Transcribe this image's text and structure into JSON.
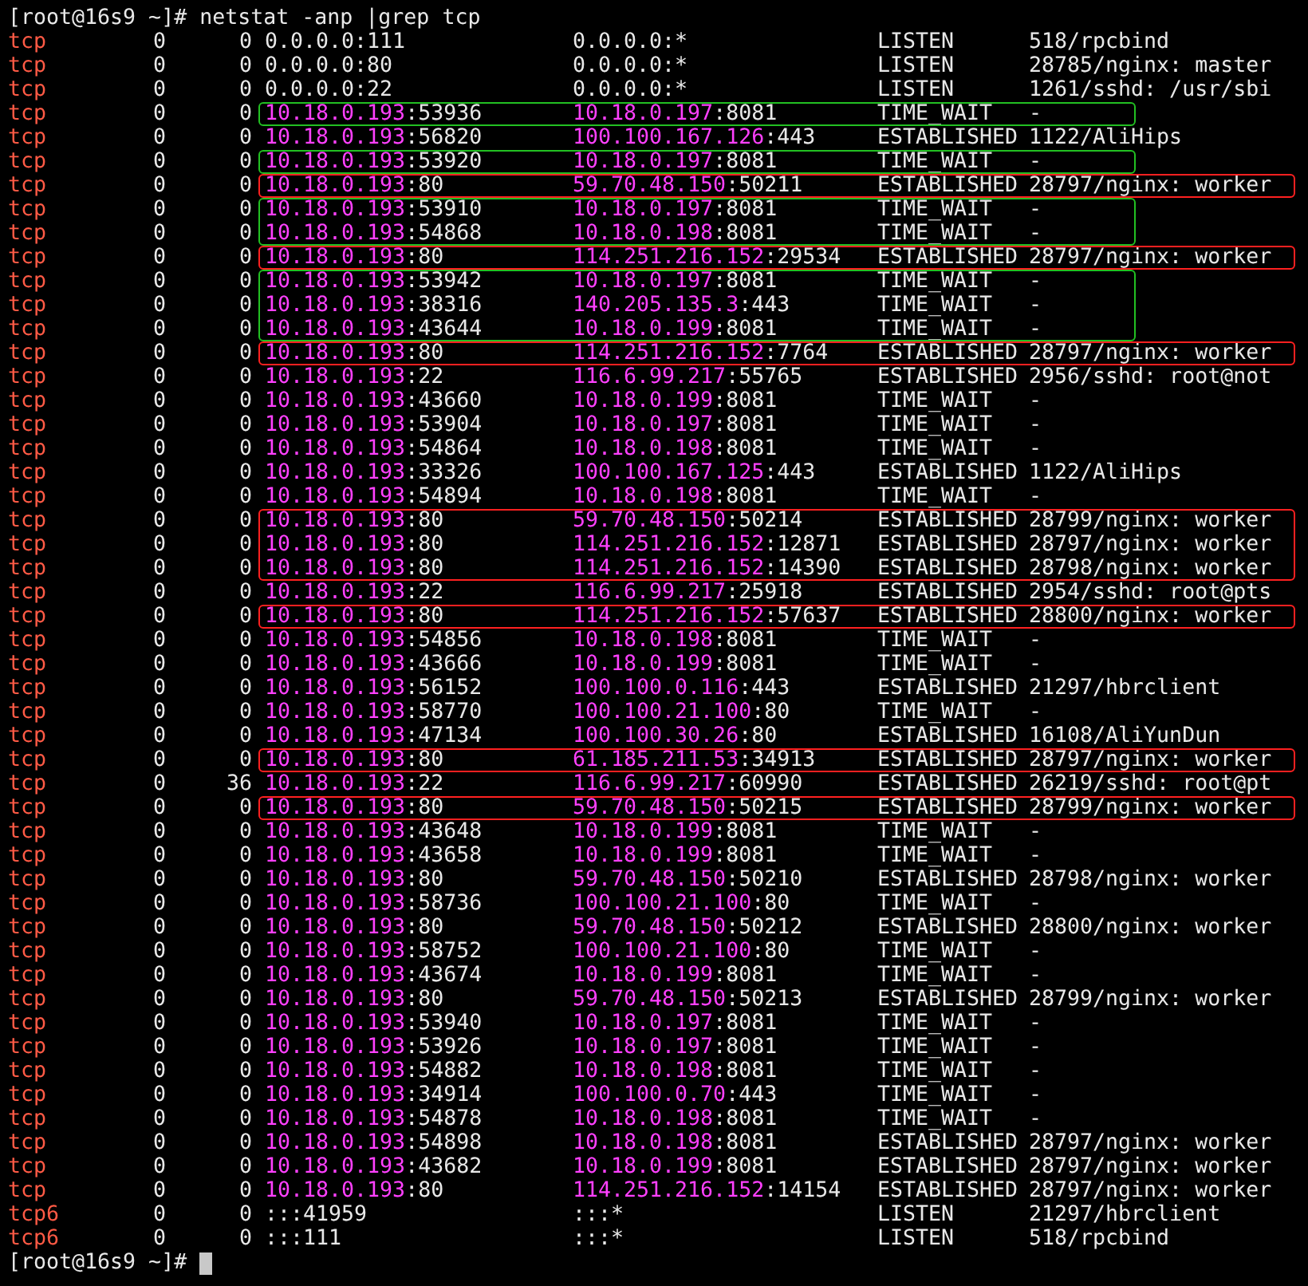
{
  "terminal": {
    "prompt": "[root@16s9 ~]#",
    "command": "netstat -anp |grep tcp",
    "lines": [
      {
        "kind": "row",
        "proto": "tcp",
        "recv_q": "0",
        "send_q": "0",
        "local": "0.0.0.0:111",
        "local_highlighted": false,
        "foreign": "0.0.0.0:*",
        "foreign_highlighted": false,
        "state": "LISTEN",
        "program": "518/rpcbind"
      },
      {
        "kind": "row",
        "proto": "tcp",
        "recv_q": "0",
        "send_q": "0",
        "local": "0.0.0.0:80",
        "local_highlighted": false,
        "foreign": "0.0.0.0:*",
        "foreign_highlighted": false,
        "state": "LISTEN",
        "program": "28785/nginx: master"
      },
      {
        "kind": "row",
        "proto": "tcp",
        "recv_q": "0",
        "send_q": "0",
        "local": "0.0.0.0:22",
        "local_highlighted": false,
        "foreign": "0.0.0.0:*",
        "foreign_highlighted": false,
        "state": "LISTEN",
        "program": "1261/sshd: /usr/sbi"
      },
      {
        "kind": "box",
        "color": "#22c022",
        "rows": [
          {
            "proto": "tcp",
            "recv_q": "0",
            "send_q": "0",
            "local": "10.18.0.193:53936",
            "local_highlighted": true,
            "foreign": "10.18.0.197:8081",
            "foreign_highlighted": true,
            "state": "TIME_WAIT",
            "program": "-"
          }
        ]
      },
      {
        "kind": "row",
        "proto": "tcp",
        "recv_q": "0",
        "send_q": "0",
        "local": "10.18.0.193:56820",
        "local_highlighted": true,
        "foreign": "100.100.167.126:443",
        "foreign_highlighted": true,
        "state": "ESTABLISHED",
        "program": "1122/AliHips"
      },
      {
        "kind": "box",
        "color": "#22c022",
        "rows": [
          {
            "proto": "tcp",
            "recv_q": "0",
            "send_q": "0",
            "local": "10.18.0.193:53920",
            "local_highlighted": true,
            "foreign": "10.18.0.197:8081",
            "foreign_highlighted": true,
            "state": "TIME_WAIT",
            "program": "-"
          }
        ]
      },
      {
        "kind": "box",
        "color": "#ff2020",
        "rows": [
          {
            "proto": "tcp",
            "recv_q": "0",
            "send_q": "0",
            "local": "10.18.0.193:80",
            "local_highlighted": true,
            "foreign": "59.70.48.150:50211",
            "foreign_highlighted": true,
            "state": "ESTABLISHED",
            "program": "28797/nginx: worker"
          }
        ]
      },
      {
        "kind": "box",
        "color": "#22c022",
        "rows": [
          {
            "proto": "tcp",
            "recv_q": "0",
            "send_q": "0",
            "local": "10.18.0.193:53910",
            "local_highlighted": true,
            "foreign": "10.18.0.197:8081",
            "foreign_highlighted": true,
            "state": "TIME_WAIT",
            "program": "-"
          },
          {
            "proto": "tcp",
            "recv_q": "0",
            "send_q": "0",
            "local": "10.18.0.193:54868",
            "local_highlighted": true,
            "foreign": "10.18.0.198:8081",
            "foreign_highlighted": true,
            "state": "TIME_WAIT",
            "program": "-"
          }
        ]
      },
      {
        "kind": "box",
        "color": "#ff2020",
        "rows": [
          {
            "proto": "tcp",
            "recv_q": "0",
            "send_q": "0",
            "local": "10.18.0.193:80",
            "local_highlighted": true,
            "foreign": "114.251.216.152:29534",
            "foreign_highlighted": true,
            "state": "ESTABLISHED",
            "program": "28797/nginx: worker"
          }
        ]
      },
      {
        "kind": "box",
        "color": "#22c022",
        "rows": [
          {
            "proto": "tcp",
            "recv_q": "0",
            "send_q": "0",
            "local": "10.18.0.193:53942",
            "local_highlighted": true,
            "foreign": "10.18.0.197:8081",
            "foreign_highlighted": true,
            "state": "TIME_WAIT",
            "program": "-"
          },
          {
            "proto": "tcp",
            "recv_q": "0",
            "send_q": "0",
            "local": "10.18.0.193:38316",
            "local_highlighted": true,
            "foreign": "140.205.135.3:443",
            "foreign_highlighted": true,
            "state": "TIME_WAIT",
            "program": "-"
          },
          {
            "proto": "tcp",
            "recv_q": "0",
            "send_q": "0",
            "local": "10.18.0.193:43644",
            "local_highlighted": true,
            "foreign": "10.18.0.199:8081",
            "foreign_highlighted": true,
            "state": "TIME_WAIT",
            "program": "-"
          }
        ]
      },
      {
        "kind": "box",
        "color": "#ff2020",
        "rows": [
          {
            "proto": "tcp",
            "recv_q": "0",
            "send_q": "0",
            "local": "10.18.0.193:80",
            "local_highlighted": true,
            "foreign": "114.251.216.152:7764",
            "foreign_highlighted": true,
            "state": "ESTABLISHED",
            "program": "28797/nginx: worker"
          }
        ]
      },
      {
        "kind": "row",
        "proto": "tcp",
        "recv_q": "0",
        "send_q": "0",
        "local": "10.18.0.193:22",
        "local_highlighted": true,
        "foreign": "116.6.99.217:55765",
        "foreign_highlighted": true,
        "state": "ESTABLISHED",
        "program": "2956/sshd: root@not"
      },
      {
        "kind": "row",
        "proto": "tcp",
        "recv_q": "0",
        "send_q": "0",
        "local": "10.18.0.193:43660",
        "local_highlighted": true,
        "foreign": "10.18.0.199:8081",
        "foreign_highlighted": true,
        "state": "TIME_WAIT",
        "program": "-"
      },
      {
        "kind": "row",
        "proto": "tcp",
        "recv_q": "0",
        "send_q": "0",
        "local": "10.18.0.193:53904",
        "local_highlighted": true,
        "foreign": "10.18.0.197:8081",
        "foreign_highlighted": true,
        "state": "TIME_WAIT",
        "program": "-"
      },
      {
        "kind": "row",
        "proto": "tcp",
        "recv_q": "0",
        "send_q": "0",
        "local": "10.18.0.193:54864",
        "local_highlighted": true,
        "foreign": "10.18.0.198:8081",
        "foreign_highlighted": true,
        "state": "TIME_WAIT",
        "program": "-"
      },
      {
        "kind": "row",
        "proto": "tcp",
        "recv_q": "0",
        "send_q": "0",
        "local": "10.18.0.193:33326",
        "local_highlighted": true,
        "foreign": "100.100.167.125:443",
        "foreign_highlighted": true,
        "state": "ESTABLISHED",
        "program": "1122/AliHips"
      },
      {
        "kind": "row",
        "proto": "tcp",
        "recv_q": "0",
        "send_q": "0",
        "local": "10.18.0.193:54894",
        "local_highlighted": true,
        "foreign": "10.18.0.198:8081",
        "foreign_highlighted": true,
        "state": "TIME_WAIT",
        "program": "-"
      },
      {
        "kind": "box",
        "color": "#ff2020",
        "rows": [
          {
            "proto": "tcp",
            "recv_q": "0",
            "send_q": "0",
            "local": "10.18.0.193:80",
            "local_highlighted": true,
            "foreign": "59.70.48.150:50214",
            "foreign_highlighted": true,
            "state": "ESTABLISHED",
            "program": "28799/nginx: worker"
          },
          {
            "proto": "tcp",
            "recv_q": "0",
            "send_q": "0",
            "local": "10.18.0.193:80",
            "local_highlighted": true,
            "foreign": "114.251.216.152:12871",
            "foreign_highlighted": true,
            "state": "ESTABLISHED",
            "program": "28797/nginx: worker"
          },
          {
            "proto": "tcp",
            "recv_q": "0",
            "send_q": "0",
            "local": "10.18.0.193:80",
            "local_highlighted": true,
            "foreign": "114.251.216.152:14390",
            "foreign_highlighted": true,
            "state": "ESTABLISHED",
            "program": "28798/nginx: worker"
          }
        ]
      },
      {
        "kind": "row",
        "proto": "tcp",
        "recv_q": "0",
        "send_q": "0",
        "local": "10.18.0.193:22",
        "local_highlighted": true,
        "foreign": "116.6.99.217:25918",
        "foreign_highlighted": true,
        "state": "ESTABLISHED",
        "program": "2954/sshd: root@pts"
      },
      {
        "kind": "box",
        "color": "#ff2020",
        "rows": [
          {
            "proto": "tcp",
            "recv_q": "0",
            "send_q": "0",
            "local": "10.18.0.193:80",
            "local_highlighted": true,
            "foreign": "114.251.216.152:57637",
            "foreign_highlighted": true,
            "state": "ESTABLISHED",
            "program": "28800/nginx: worker"
          }
        ]
      },
      {
        "kind": "row",
        "proto": "tcp",
        "recv_q": "0",
        "send_q": "0",
        "local": "10.18.0.193:54856",
        "local_highlighted": true,
        "foreign": "10.18.0.198:8081",
        "foreign_highlighted": true,
        "state": "TIME_WAIT",
        "program": "-"
      },
      {
        "kind": "row",
        "proto": "tcp",
        "recv_q": "0",
        "send_q": "0",
        "local": "10.18.0.193:43666",
        "local_highlighted": true,
        "foreign": "10.18.0.199:8081",
        "foreign_highlighted": true,
        "state": "TIME_WAIT",
        "program": "-"
      },
      {
        "kind": "row",
        "proto": "tcp",
        "recv_q": "0",
        "send_q": "0",
        "local": "10.18.0.193:56152",
        "local_highlighted": true,
        "foreign": "100.100.0.116:443",
        "foreign_highlighted": true,
        "state": "ESTABLISHED",
        "program": "21297/hbrclient"
      },
      {
        "kind": "row",
        "proto": "tcp",
        "recv_q": "0",
        "send_q": "0",
        "local": "10.18.0.193:58770",
        "local_highlighted": true,
        "foreign": "100.100.21.100:80",
        "foreign_highlighted": true,
        "state": "TIME_WAIT",
        "program": "-"
      },
      {
        "kind": "row",
        "proto": "tcp",
        "recv_q": "0",
        "send_q": "0",
        "local": "10.18.0.193:47134",
        "local_highlighted": true,
        "foreign": "100.100.30.26:80",
        "foreign_highlighted": true,
        "state": "ESTABLISHED",
        "program": "16108/AliYunDun"
      },
      {
        "kind": "box",
        "color": "#ff2020",
        "rows": [
          {
            "proto": "tcp",
            "recv_q": "0",
            "send_q": "0",
            "local": "10.18.0.193:80",
            "local_highlighted": true,
            "foreign": "61.185.211.53:34913",
            "foreign_highlighted": true,
            "state": "ESTABLISHED",
            "program": "28797/nginx: worker"
          }
        ]
      },
      {
        "kind": "row",
        "proto": "tcp",
        "recv_q": "0",
        "send_q": "36",
        "local": "10.18.0.193:22",
        "local_highlighted": true,
        "foreign": "116.6.99.217:60990",
        "foreign_highlighted": true,
        "state": "ESTABLISHED",
        "program": "26219/sshd: root@pt"
      },
      {
        "kind": "box",
        "color": "#ff2020",
        "rows": [
          {
            "proto": "tcp",
            "recv_q": "0",
            "send_q": "0",
            "local": "10.18.0.193:80",
            "local_highlighted": true,
            "foreign": "59.70.48.150:50215",
            "foreign_highlighted": true,
            "state": "ESTABLISHED",
            "program": "28799/nginx: worker"
          }
        ]
      },
      {
        "kind": "row",
        "proto": "tcp",
        "recv_q": "0",
        "send_q": "0",
        "local": "10.18.0.193:43648",
        "local_highlighted": true,
        "foreign": "10.18.0.199:8081",
        "foreign_highlighted": true,
        "state": "TIME_WAIT",
        "program": "-"
      },
      {
        "kind": "row",
        "proto": "tcp",
        "recv_q": "0",
        "send_q": "0",
        "local": "10.18.0.193:43658",
        "local_highlighted": true,
        "foreign": "10.18.0.199:8081",
        "foreign_highlighted": true,
        "state": "TIME_WAIT",
        "program": "-"
      },
      {
        "kind": "row",
        "proto": "tcp",
        "recv_q": "0",
        "send_q": "0",
        "local": "10.18.0.193:80",
        "local_highlighted": true,
        "foreign": "59.70.48.150:50210",
        "foreign_highlighted": true,
        "state": "ESTABLISHED",
        "program": "28798/nginx: worker"
      },
      {
        "kind": "row",
        "proto": "tcp",
        "recv_q": "0",
        "send_q": "0",
        "local": "10.18.0.193:58736",
        "local_highlighted": true,
        "foreign": "100.100.21.100:80",
        "foreign_highlighted": true,
        "state": "TIME_WAIT",
        "program": "-"
      },
      {
        "kind": "row",
        "proto": "tcp",
        "recv_q": "0",
        "send_q": "0",
        "local": "10.18.0.193:80",
        "local_highlighted": true,
        "foreign": "59.70.48.150:50212",
        "foreign_highlighted": true,
        "state": "ESTABLISHED",
        "program": "28800/nginx: worker"
      },
      {
        "kind": "row",
        "proto": "tcp",
        "recv_q": "0",
        "send_q": "0",
        "local": "10.18.0.193:58752",
        "local_highlighted": true,
        "foreign": "100.100.21.100:80",
        "foreign_highlighted": true,
        "state": "TIME_WAIT",
        "program": "-"
      },
      {
        "kind": "row",
        "proto": "tcp",
        "recv_q": "0",
        "send_q": "0",
        "local": "10.18.0.193:43674",
        "local_highlighted": true,
        "foreign": "10.18.0.199:8081",
        "foreign_highlighted": true,
        "state": "TIME_WAIT",
        "program": "-"
      },
      {
        "kind": "row",
        "proto": "tcp",
        "recv_q": "0",
        "send_q": "0",
        "local": "10.18.0.193:80",
        "local_highlighted": true,
        "foreign": "59.70.48.150:50213",
        "foreign_highlighted": true,
        "state": "ESTABLISHED",
        "program": "28799/nginx: worker"
      },
      {
        "kind": "row",
        "proto": "tcp",
        "recv_q": "0",
        "send_q": "0",
        "local": "10.18.0.193:53940",
        "local_highlighted": true,
        "foreign": "10.18.0.197:8081",
        "foreign_highlighted": true,
        "state": "TIME_WAIT",
        "program": "-"
      },
      {
        "kind": "row",
        "proto": "tcp",
        "recv_q": "0",
        "send_q": "0",
        "local": "10.18.0.193:53926",
        "local_highlighted": true,
        "foreign": "10.18.0.197:8081",
        "foreign_highlighted": true,
        "state": "TIME_WAIT",
        "program": "-"
      },
      {
        "kind": "row",
        "proto": "tcp",
        "recv_q": "0",
        "send_q": "0",
        "local": "10.18.0.193:54882",
        "local_highlighted": true,
        "foreign": "10.18.0.198:8081",
        "foreign_highlighted": true,
        "state": "TIME_WAIT",
        "program": "-"
      },
      {
        "kind": "row",
        "proto": "tcp",
        "recv_q": "0",
        "send_q": "0",
        "local": "10.18.0.193:34914",
        "local_highlighted": true,
        "foreign": "100.100.0.70:443",
        "foreign_highlighted": true,
        "state": "TIME_WAIT",
        "program": "-"
      },
      {
        "kind": "row",
        "proto": "tcp",
        "recv_q": "0",
        "send_q": "0",
        "local": "10.18.0.193:54878",
        "local_highlighted": true,
        "foreign": "10.18.0.198:8081",
        "foreign_highlighted": true,
        "state": "TIME_WAIT",
        "program": "-"
      },
      {
        "kind": "row",
        "proto": "tcp",
        "recv_q": "0",
        "send_q": "0",
        "local": "10.18.0.193:54898",
        "local_highlighted": true,
        "foreign": "10.18.0.198:8081",
        "foreign_highlighted": true,
        "state": "ESTABLISHED",
        "program": "28797/nginx: worker"
      },
      {
        "kind": "row",
        "proto": "tcp",
        "recv_q": "0",
        "send_q": "0",
        "local": "10.18.0.193:43682",
        "local_highlighted": true,
        "foreign": "10.18.0.199:8081",
        "foreign_highlighted": true,
        "state": "ESTABLISHED",
        "program": "28797/nginx: worker"
      },
      {
        "kind": "row",
        "proto": "tcp",
        "recv_q": "0",
        "send_q": "0",
        "local": "10.18.0.193:80",
        "local_highlighted": true,
        "foreign": "114.251.216.152:14154",
        "foreign_highlighted": true,
        "state": "ESTABLISHED",
        "program": "28797/nginx: worker"
      },
      {
        "kind": "row",
        "proto": "tcp6",
        "recv_q": "0",
        "send_q": "0",
        "local": ":::41959",
        "local_highlighted": false,
        "foreign": ":::*",
        "foreign_highlighted": false,
        "state": "LISTEN",
        "program": "21297/hbrclient"
      },
      {
        "kind": "row",
        "proto": "tcp6",
        "recv_q": "0",
        "send_q": "0",
        "local": ":::111",
        "local_highlighted": false,
        "foreign": ":::*",
        "foreign_highlighted": false,
        "state": "LISTEN",
        "program": "518/rpcbind"
      }
    ],
    "final_prompt": "[root@16s9 ~]#"
  }
}
